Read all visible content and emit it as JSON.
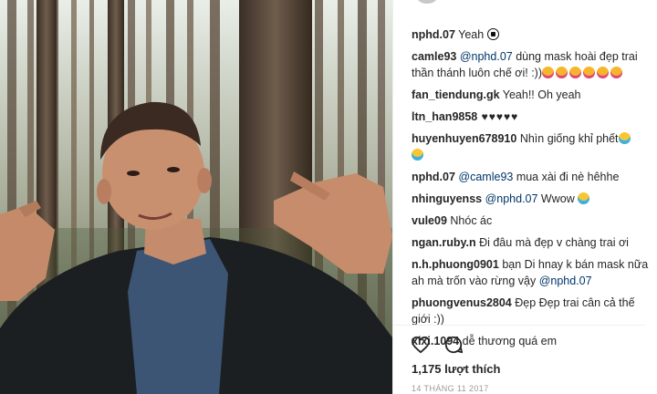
{
  "post": {
    "comments": [
      {
        "user": "nphd.07",
        "text": " Yeah ",
        "emoji": [
          "soccer-ball"
        ]
      },
      {
        "user": "camle93",
        "mention": "@nphd.07",
        "text": " dùng mask hoài đẹp trai thần thánh luôn chế ơi! :))",
        "emoji": [
          "yum",
          "yum",
          "yum",
          "yum",
          "yum",
          "yum"
        ]
      },
      {
        "user": "fan_tiendung.gk",
        "text": " Yeah!! Oh yeah"
      },
      {
        "user": "ltn_han9858",
        "text": " ♥♥♥♥♥"
      },
      {
        "user": "huyenhuyen678910",
        "text": " Nhìn giống khỉ phết",
        "emoji": [
          "grin",
          "grin"
        ]
      },
      {
        "user": "nphd.07",
        "mention": "@camle93",
        "text": " mua xài đi nè hêhhe"
      },
      {
        "user": "nhinguyenss",
        "mention": "@nphd.07",
        "text": " Wwow ",
        "emoji": [
          "grin"
        ]
      },
      {
        "user": "vule09",
        "text": " Nhóc ác"
      },
      {
        "user": "ngan.ruby.n",
        "text": " Đi đâu mà đẹp v chàng trai ơi"
      },
      {
        "user": "n.h.phuong0901",
        "text": " bạn Di hnay k bán mask nữa ah mà trốn vào rừng vậy ",
        "mention_after": "@nphd.07"
      },
      {
        "user": "phuongvenus2804",
        "text": " Đẹp Đẹp trai cân cả thế giới :))"
      },
      {
        "user": "xixi.1094",
        "text": " dễ thương quá em"
      }
    ],
    "likes_label": "1,175 lượt thích",
    "date_label": "14 THÁNG 11 2017"
  },
  "icons": {
    "like": "heart-outline-icon",
    "comment": "speech-bubble-icon"
  },
  "colors": {
    "text": "#262626",
    "mention": "#003569",
    "muted": "#999999",
    "divider": "#efefef"
  }
}
